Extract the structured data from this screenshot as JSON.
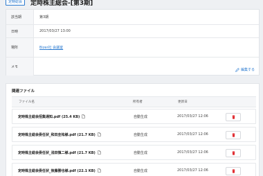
{
  "header": {
    "badge": "定時総会",
    "title": "定時株主総会-[第3期]"
  },
  "details": [
    {
      "label": "該当期",
      "value": "第3期",
      "link": false
    },
    {
      "label": "日時",
      "value": "2017/03/27 13:00",
      "link": false
    },
    {
      "label": "場所",
      "value": "Bizer社 会議室",
      "link": true
    },
    {
      "label": "メモ",
      "value": "",
      "link": false
    }
  ],
  "edit_label": "編集する",
  "files": {
    "section_title": "関連ファイル",
    "columns": {
      "name": "ファイル名",
      "owner": "所有者",
      "updated": "更新日"
    },
    "rows": [
      {
        "name": "定時株主総会招集通知.pdf (25.4 KB)",
        "owner": "自動生成",
        "updated": "2017/03/27 12:06"
      },
      {
        "name": "定時株主総会委任状_和田圭祐様.pdf (21.7 KB)",
        "owner": "自動生成",
        "updated": "2017/03/27 12:06"
      },
      {
        "name": "定時株主総会委任状_浅田慎二様.pdf (21.7 KB)",
        "owner": "自動生成",
        "updated": "2017/03/27 12:06"
      },
      {
        "name": "定時株主総会委任状_後藤勝也様.pdf (22.1 KB)",
        "owner": "自動生成",
        "updated": "2017/03/27 12:06"
      }
    ]
  },
  "colors": {
    "accent": "#2a7ad0",
    "delete": "#e0282d"
  }
}
